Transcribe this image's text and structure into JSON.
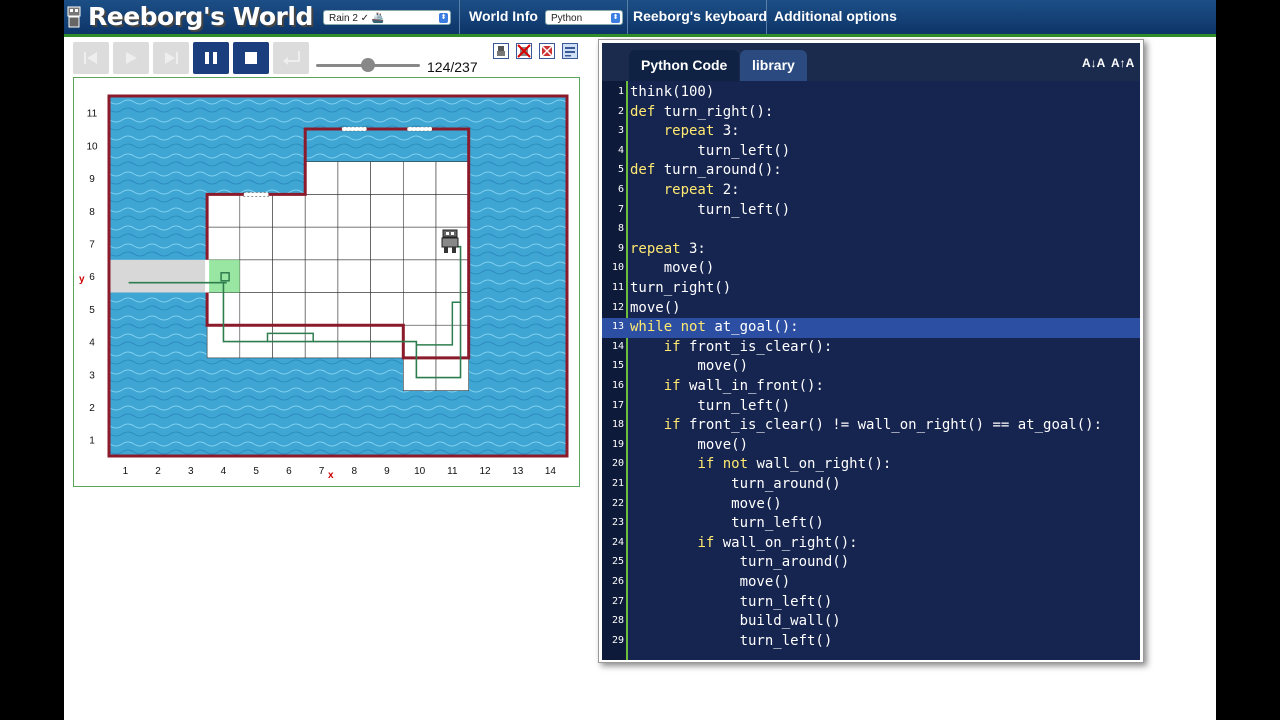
{
  "header": {
    "title": "Reeborg's World",
    "world_select": "Rain 2 ✓ 🚢",
    "world_info_label": "World Info",
    "language_select": "Python",
    "keyboard_label": "Reeborg's keyboard",
    "options_label": "Additional options"
  },
  "controls": {
    "step_counter": "124/237",
    "slider_progress": 0.5
  },
  "world": {
    "x_axis_labels": [
      "1",
      "2",
      "3",
      "4",
      "5",
      "6",
      "7",
      "8",
      "9",
      "10",
      "11",
      "12",
      "13",
      "14"
    ],
    "y_axis_labels": [
      "1",
      "2",
      "3",
      "4",
      "5",
      "6",
      "7",
      "8",
      "9",
      "10",
      "11"
    ],
    "x_marker": "x",
    "y_marker": "y",
    "colors": {
      "water": "#3fa6d4",
      "wall": "#8b1a2b",
      "path": "#2e7d4f",
      "goal": "#7ee08a"
    }
  },
  "editor": {
    "tabs": [
      "Python Code",
      "library"
    ],
    "font_smaller": "A↓A",
    "font_larger": "A↑A",
    "highlighted_line": 13,
    "lines": [
      {
        "n": "1",
        "text": "think(100)"
      },
      {
        "n": "2",
        "text": "def turn_right():"
      },
      {
        "n": "3",
        "text": "    repeat 3:"
      },
      {
        "n": "4",
        "text": "        turn_left()"
      },
      {
        "n": "5",
        "text": "def turn_around():"
      },
      {
        "n": "6",
        "text": "    repeat 2:"
      },
      {
        "n": "7",
        "text": "        turn_left()"
      },
      {
        "n": "8",
        "text": ""
      },
      {
        "n": "9",
        "text": "repeat 3:"
      },
      {
        "n": "10",
        "text": "    move()"
      },
      {
        "n": "11",
        "text": "turn_right()"
      },
      {
        "n": "12",
        "text": "move()"
      },
      {
        "n": "13",
        "text": "while not at_goal():"
      },
      {
        "n": "14",
        "text": "    if front_is_clear():"
      },
      {
        "n": "15",
        "text": "        move()"
      },
      {
        "n": "16",
        "text": "    if wall_in_front():"
      },
      {
        "n": "17",
        "text": "        turn_left()"
      },
      {
        "n": "18",
        "text": "    if front_is_clear() != wall_on_right() == at_goal():"
      },
      {
        "n": "19",
        "text": "        move()"
      },
      {
        "n": "20",
        "text": "        if not wall_on_right():"
      },
      {
        "n": "21",
        "text": "            turn_around()"
      },
      {
        "n": "22",
        "text": "            move()"
      },
      {
        "n": "23",
        "text": "            turn_left()"
      },
      {
        "n": "24",
        "text": "        if wall_on_right():"
      },
      {
        "n": "25",
        "text": "             turn_around()"
      },
      {
        "n": "26",
        "text": "             move()"
      },
      {
        "n": "27",
        "text": "             turn_left()"
      },
      {
        "n": "28",
        "text": "             build_wall()"
      },
      {
        "n": "29",
        "text": "             turn_left()"
      }
    ]
  }
}
